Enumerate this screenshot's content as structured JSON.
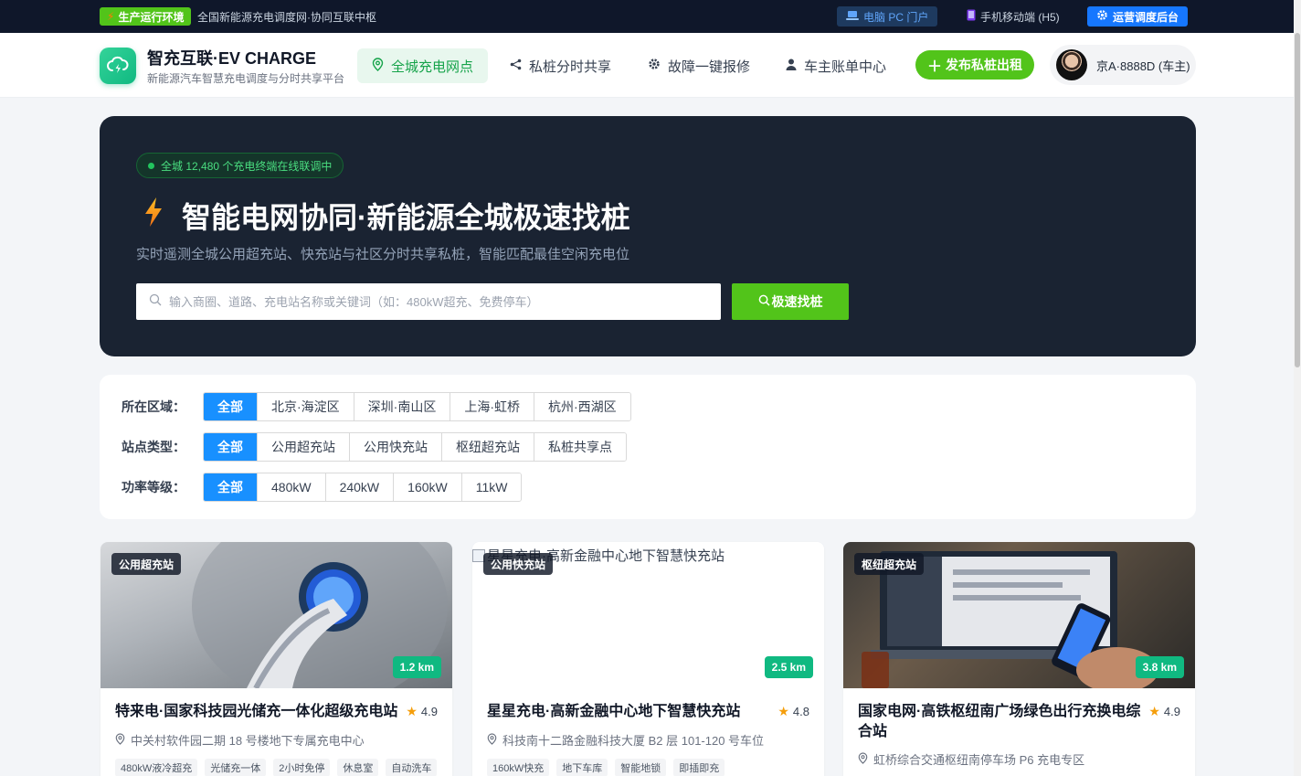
{
  "topbar": {
    "env_badge": "生产运行环境",
    "description": "全国新能源充电调度网·协同互联中枢",
    "pc_portal": "电脑 PC 门户",
    "h5": "手机移动端 (H5)",
    "admin": "运营调度后台"
  },
  "header": {
    "brand_title": "智充互联·EV CHARGE",
    "brand_subtitle": "新能源汽车智慧充电调度与分时共享平台",
    "nav": [
      {
        "label": "全城充电网点",
        "icon": "location-icon"
      },
      {
        "label": "私桩分时共享",
        "icon": "share-icon"
      },
      {
        "label": "故障一键报修",
        "icon": "gear-icon"
      },
      {
        "label": "车主账单中心",
        "icon": "user-icon"
      }
    ],
    "publish_label": "发布私桩出租",
    "user_name": "京A·8888D (车主)"
  },
  "hero": {
    "status_pill": "全城 12,480 个充电终端在线联调中",
    "title": "智能电网协同·新能源全城极速找桩",
    "description": "实时遥测全城公用超充站、快充站与社区分时共享私桩，智能匹配最佳空闲充电位",
    "search_placeholder": "输入商圈、道路、充电站名称或关键词（如：480kW超充、免费停车）",
    "search_button": "极速找桩"
  },
  "filters": {
    "region": {
      "label": "所在区域：",
      "options": [
        "全部",
        "北京·海淀区",
        "深圳·南山区",
        "上海·虹桥",
        "杭州·西湖区"
      ],
      "selected": "全部"
    },
    "type": {
      "label": "站点类型：",
      "options": [
        "全部",
        "公用超充站",
        "公用快充站",
        "枢纽超充站",
        "私桩共享点"
      ],
      "selected": "全部"
    },
    "power": {
      "label": "功率等级：",
      "options": [
        "全部",
        "480kW",
        "240kW",
        "160kW",
        "11kW"
      ],
      "selected": "全部"
    }
  },
  "stations": [
    {
      "tag": "公用超充站",
      "distance": "1.2 km",
      "name": "特来电·国家科技园光储充一体化超级充电站",
      "rating": "4.9",
      "address": "中关村软件园二期 18 号楼地下专属充电中心",
      "chips": [
        "480kW液冷超充",
        "光储充一体",
        "2小时免停",
        "休息室",
        "自动洗车"
      ]
    },
    {
      "tag": "公用快充站",
      "distance": "2.5 km",
      "image_alt": "星星充电·高新金融中心地下智慧快充站",
      "name": "星星充电·高新金融中心地下智慧快充站",
      "rating": "4.8",
      "address": "科技南十二路金融科技大厦 B2 层 101-120 号车位",
      "chips": [
        "160kW快充",
        "地下车库",
        "智能地锁",
        "即插即充"
      ]
    },
    {
      "tag": "枢纽超充站",
      "distance": "3.8 km",
      "name": "国家电网·高铁枢纽南广场绿色出行充换电综合站",
      "rating": "4.9",
      "address": "虹桥综合交通枢纽南停车场 P6 充电专区",
      "chips": []
    }
  ],
  "colors": {
    "topbar_bg": "#0f172a",
    "hero_bg": "#1a2332",
    "accent_green": "#52c41a",
    "filter_active": "#1890ff",
    "distance_badge": "#10b981"
  }
}
